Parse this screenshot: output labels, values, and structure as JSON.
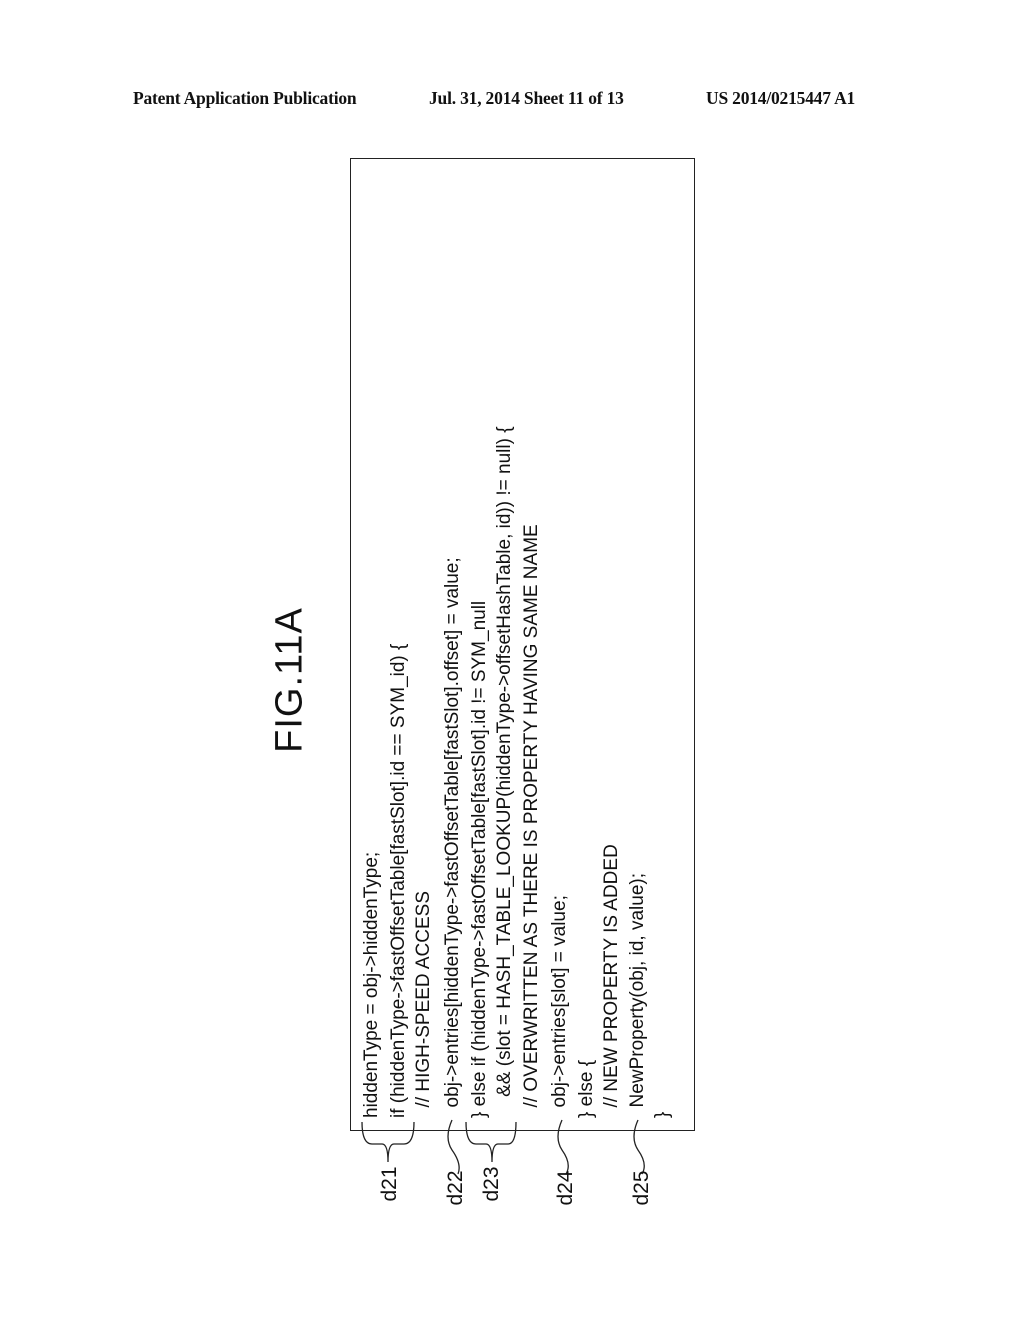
{
  "header": {
    "left": "Patent Application Publication",
    "middle": "Jul. 31, 2014   Sheet 11 of 13",
    "right": "US 2014/0215447 A1"
  },
  "figure": {
    "title": "FIG.11A",
    "code_lines": [
      "hiddenType = obj->hiddenType;",
      "if (hiddenType->fastOffsetTable[fastSlot].id == SYM_id) {",
      "  // HIGH-SPEED ACCESS",
      "  obj->entries[hiddenType->fastOffsetTable[fastSlot].offset] = value;",
      "} else if (hiddenType->fastOffsetTable[fastSlot].id != SYM_null",
      "    && (slot = HASH_TABLE_LOOKUP(hiddenType->offsetHashTable, id)) != null) {",
      "  // OVERWRITTEN AS THERE IS PROPERTY HAVING SAME NAME",
      "  obj->entries[slot] = value;",
      "} else {",
      "  // NEW PROPERTY IS ADDED",
      "  NewProperty(obj, id, value);",
      "}"
    ],
    "reference_labels": [
      "d21",
      "d22",
      "d23",
      "d24",
      "d25"
    ]
  }
}
